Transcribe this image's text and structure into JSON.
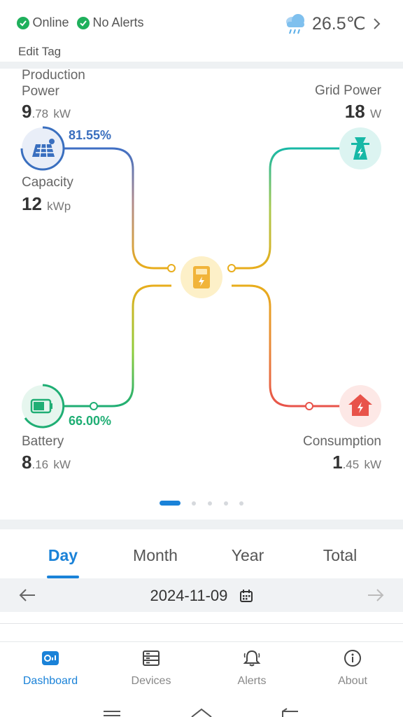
{
  "status": {
    "online": "Online",
    "alerts": "No Alerts",
    "weather_icon": "cloud-rain-icon",
    "temperature": "26.5℃"
  },
  "edit_tag": "Edit Tag",
  "flow": {
    "production": {
      "label_line1": "Production",
      "label_line2": "Power",
      "int": "9",
      "dec": ".78",
      "unit": "kW",
      "percent": "81.55%"
    },
    "capacity": {
      "label": "Capacity",
      "value": "12",
      "unit": "kWp"
    },
    "grid": {
      "label": "Grid Power",
      "value": "18",
      "unit": "W"
    },
    "battery": {
      "label": "Battery",
      "int": "8",
      "dec": ".16",
      "unit": "kW",
      "percent": "66.00%"
    },
    "consumption": {
      "label": "Consumption",
      "int": "1",
      "dec": ".45",
      "unit": "kW"
    },
    "inverter_icon": "inverter-icon"
  },
  "pager": {
    "count": 5,
    "active": 0
  },
  "tabs": [
    {
      "label": "Day",
      "active": true
    },
    {
      "label": "Month",
      "active": false
    },
    {
      "label": "Year",
      "active": false
    },
    {
      "label": "Total",
      "active": false
    }
  ],
  "date": {
    "value": "2024-11-09"
  },
  "nav": [
    {
      "label": "Dashboard",
      "icon": "dashboard-icon",
      "active": true
    },
    {
      "label": "Devices",
      "icon": "devices-icon",
      "active": false
    },
    {
      "label": "Alerts",
      "icon": "bell-icon",
      "active": false
    },
    {
      "label": "About",
      "icon": "info-icon",
      "active": false
    }
  ],
  "colors": {
    "accent": "#1a82d8",
    "online": "#1fb05c",
    "solar": "#3a6fbf",
    "grid": "#17b8a6",
    "battery": "#1fae74",
    "consumption": "#e8534a",
    "inverter": "#f1b43a"
  }
}
